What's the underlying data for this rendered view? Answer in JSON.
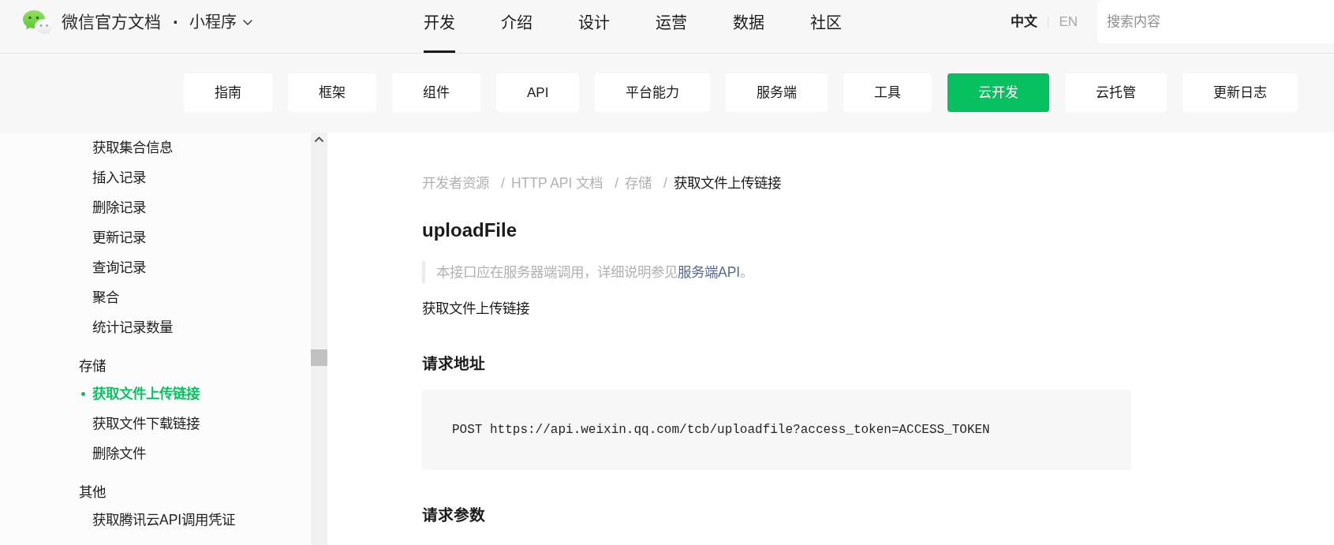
{
  "header": {
    "site_title": "微信官方文档",
    "separator": "·",
    "product": "小程序",
    "nav": [
      {
        "label": "开发",
        "selected": true
      },
      {
        "label": "介绍",
        "selected": false
      },
      {
        "label": "设计",
        "selected": false
      },
      {
        "label": "运营",
        "selected": false
      },
      {
        "label": "数据",
        "selected": false
      },
      {
        "label": "社区",
        "selected": false
      }
    ],
    "languages": [
      {
        "label": "中文",
        "selected": true
      },
      {
        "label": "EN",
        "selected": false
      }
    ],
    "search": {
      "placeholder": "搜索内容"
    }
  },
  "subnav": [
    {
      "label": "指南",
      "selected": false
    },
    {
      "label": "框架",
      "selected": false
    },
    {
      "label": "组件",
      "selected": false
    },
    {
      "label": "API",
      "selected": false
    },
    {
      "label": "平台能力",
      "selected": false
    },
    {
      "label": "服务端",
      "selected": false
    },
    {
      "label": "工具",
      "selected": false
    },
    {
      "label": "云开发",
      "selected": true
    },
    {
      "label": "云托管",
      "selected": false
    },
    {
      "label": "更新日志",
      "selected": false
    }
  ],
  "sidebar": {
    "groups": [
      {
        "items": [
          {
            "label": "获取集合信息",
            "selected": false
          },
          {
            "label": "插入记录",
            "selected": false
          },
          {
            "label": "删除记录",
            "selected": false
          },
          {
            "label": "更新记录",
            "selected": false
          },
          {
            "label": "查询记录",
            "selected": false
          },
          {
            "label": "聚合",
            "selected": false
          },
          {
            "label": "统计记录数量",
            "selected": false
          }
        ]
      },
      {
        "title": "存储",
        "items": [
          {
            "label": "获取文件上传链接",
            "selected": true
          },
          {
            "label": "获取文件下载链接",
            "selected": false
          },
          {
            "label": "删除文件",
            "selected": false
          }
        ]
      },
      {
        "title": "其他",
        "items": [
          {
            "label": "获取腾讯云API调用凭证",
            "selected": false
          }
        ]
      }
    ]
  },
  "content": {
    "breadcrumb": [
      {
        "label": "开发者资源",
        "current": false
      },
      {
        "separator": "/",
        "label": "HTTP API 文档",
        "current": false
      },
      {
        "separator": "/",
        "label": "存储",
        "current": false
      },
      {
        "separator": "/",
        "label": "获取文件上传链接",
        "current": true
      }
    ],
    "title": "uploadFile",
    "note": {
      "text": "本接口应在服务器端调用，详细说明参见",
      "link": "服务端API",
      "after": "。"
    },
    "description": "获取文件上传链接",
    "sections": [
      {
        "heading": "请求地址",
        "code": "POST https://api.weixin.qq.com/tcb/uploadfile?access_token=ACCESS_TOKEN"
      },
      {
        "heading": "请求参数"
      }
    ]
  }
}
